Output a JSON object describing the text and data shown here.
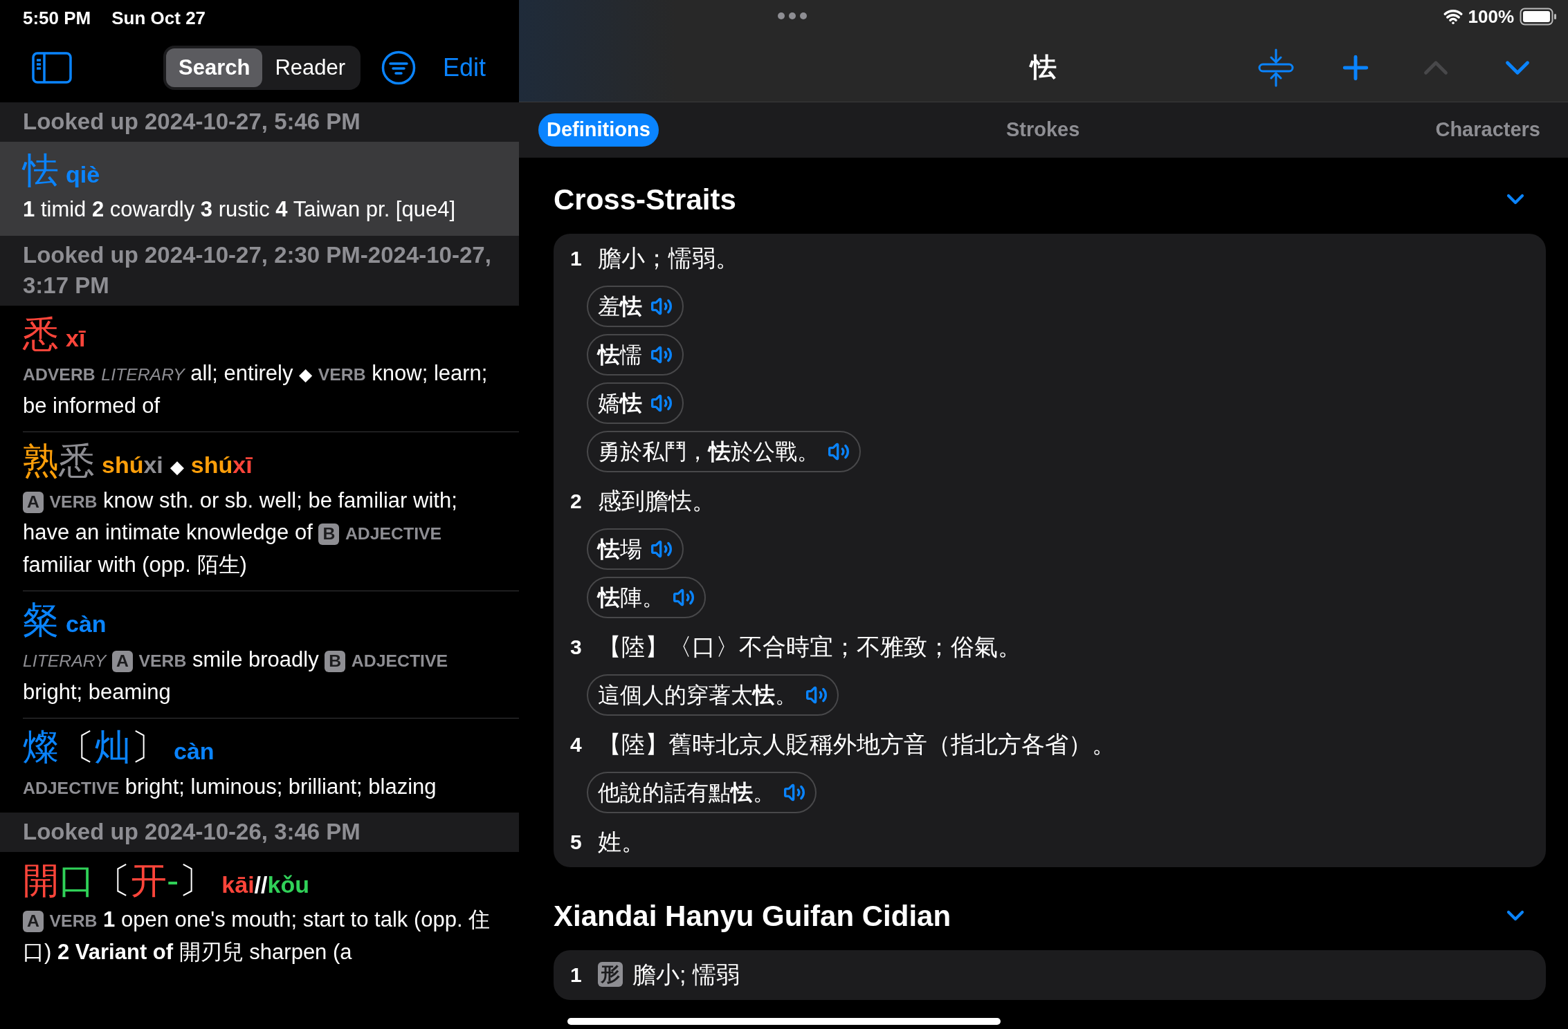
{
  "status_bar": {
    "time": "5:50 PM",
    "date": "Sun Oct 27",
    "battery": "100%"
  },
  "sidebar": {
    "modes": [
      {
        "label": "Search",
        "selected": true
      },
      {
        "label": "Reader",
        "selected": false
      }
    ],
    "edit": "Edit",
    "groups": [
      {
        "header": "Looked up 2024-10-27, 5:46 PM",
        "entries": [
          {
            "selected": true,
            "headword": [
              {
                "text": "怯",
                "color": "#0a84ff"
              }
            ],
            "readings": [
              [
                {
                  "text": "qiè",
                  "color": "#0a84ff"
                }
              ]
            ],
            "definition": [
              {
                "kind": "num",
                "text": "1"
              },
              {
                "kind": "text",
                "text": "timid"
              },
              {
                "kind": "num",
                "text": "2"
              },
              {
                "kind": "text",
                "text": "cowardly"
              },
              {
                "kind": "num",
                "text": "3"
              },
              {
                "kind": "text",
                "text": "rustic"
              },
              {
                "kind": "num",
                "text": "4"
              },
              {
                "kind": "text",
                "text": "Taiwan pr. [que4]"
              }
            ]
          }
        ]
      },
      {
        "header": "Looked up 2024-10-27, 2:30 PM-2024-10-27, 3:17 PM",
        "entries": [
          {
            "selected": false,
            "headword": [
              {
                "text": "悉",
                "color": "#ff453a"
              }
            ],
            "readings": [
              [
                {
                  "text": "xī",
                  "color": "#ff453a"
                }
              ]
            ],
            "definition": [
              {
                "kind": "pos",
                "text": "ADVERB"
              },
              {
                "kind": "register",
                "text": "LITERARY"
              },
              {
                "kind": "text",
                "text": "all; entirely"
              },
              {
                "kind": "sep",
                "text": "◆"
              },
              {
                "kind": "pos",
                "text": "VERB"
              },
              {
                "kind": "text",
                "text": "know; learn; be informed of"
              }
            ]
          },
          {
            "selected": false,
            "headword": [
              {
                "text": "熟",
                "color": "#ff9f0a"
              },
              {
                "text": "悉",
                "color": "#8e8e93"
              }
            ],
            "reading_separator": "◆",
            "readings": [
              [
                {
                  "text": "shú",
                  "color": "#ff9f0a"
                },
                {
                  "text": "xi",
                  "color": "#8e8e93"
                }
              ],
              [
                {
                  "text": "shú",
                  "color": "#ff9f0a"
                },
                {
                  "text": "xī",
                  "color": "#ff453a"
                }
              ]
            ],
            "definition": [
              {
                "kind": "badge",
                "text": "A"
              },
              {
                "kind": "pos",
                "text": "VERB"
              },
              {
                "kind": "text",
                "text": "know sth. or sb. well; be familiar with; have an intimate knowledge of"
              },
              {
                "kind": "badge",
                "text": "B"
              },
              {
                "kind": "pos",
                "text": "ADJECTIVE"
              },
              {
                "kind": "text",
                "text": "familiar with (opp. 陌生)"
              }
            ]
          },
          {
            "selected": false,
            "headword": [
              {
                "text": "粲",
                "color": "#0a84ff"
              }
            ],
            "readings": [
              [
                {
                  "text": "càn",
                  "color": "#0a84ff"
                }
              ]
            ],
            "definition": [
              {
                "kind": "register",
                "text": "LITERARY"
              },
              {
                "kind": "badge",
                "text": "A"
              },
              {
                "kind": "pos",
                "text": "VERB"
              },
              {
                "kind": "text",
                "text": "smile broadly"
              },
              {
                "kind": "badge",
                "text": "B"
              },
              {
                "kind": "pos",
                "text": "ADJECTIVE"
              },
              {
                "kind": "text",
                "text": "bright; beaming"
              }
            ]
          },
          {
            "selected": false,
            "headword": [
              {
                "text": "燦",
                "color": "#0a84ff"
              },
              {
                "text": "〔",
                "color": "#ffffff"
              },
              {
                "text": "灿",
                "color": "#0a84ff"
              },
              {
                "text": "〕",
                "color": "#ffffff"
              }
            ],
            "readings": [
              [
                {
                  "text": "càn",
                  "color": "#0a84ff"
                }
              ]
            ],
            "definition": [
              {
                "kind": "pos",
                "text": "ADJECTIVE"
              },
              {
                "kind": "text",
                "text": "bright; luminous; brilliant; blazing"
              }
            ]
          }
        ]
      },
      {
        "header": "Looked up 2024-10-26, 3:46 PM",
        "entries": [
          {
            "selected": false,
            "headword": [
              {
                "text": "開",
                "color": "#ff453a"
              },
              {
                "text": "口",
                "color": "#30d158"
              },
              {
                "text": "〔",
                "color": "#ffffff"
              },
              {
                "text": "开",
                "color": "#ff453a"
              },
              {
                "text": "-",
                "color": "#30d158"
              },
              {
                "text": "〕",
                "color": "#ffffff"
              }
            ],
            "readings": [
              [
                {
                  "text": "kāi",
                  "color": "#ff453a"
                },
                {
                  "text": "//",
                  "color": "#ffffff"
                },
                {
                  "text": "kǒu",
                  "color": "#30d158"
                }
              ]
            ],
            "definition": [
              {
                "kind": "badge",
                "text": "A"
              },
              {
                "kind": "pos",
                "text": "VERB"
              },
              {
                "kind": "num",
                "text": "1"
              },
              {
                "kind": "text",
                "text": "open one's mouth; start to talk (opp. 住口)"
              },
              {
                "kind": "num",
                "text": "2"
              },
              {
                "kind": "bold",
                "text": "Variant of"
              },
              {
                "kind": "text",
                "text": "開刃兒 sharpen (a"
              }
            ]
          }
        ]
      }
    ]
  },
  "detail": {
    "title": "怯",
    "previous_disabled": true,
    "next_disabled": false,
    "tabs": [
      {
        "label": "Definitions",
        "selected": true
      },
      {
        "label": "Strokes",
        "selected": false
      },
      {
        "label": "Characters",
        "selected": false
      }
    ],
    "dictionaries": [
      {
        "name": "Cross-Straits",
        "expanded": true,
        "senses": [
          {
            "number": "1",
            "text": "膽小；懦弱。",
            "examples": [
              "羞**怯**",
              "**怯**懦",
              "嬌**怯**",
              "勇於私鬥，**怯**於公戰。"
            ]
          },
          {
            "number": "2",
            "text": "感到膽怯。",
            "examples": [
              "**怯**場",
              "**怯**陣。"
            ]
          },
          {
            "number": "3",
            "text": "【陸】〈口〉不合時宜；不雅致；俗氣。",
            "examples": [
              "這個人的穿著太**怯**。"
            ]
          },
          {
            "number": "4",
            "text": "【陸】舊時北京人貶稱外地方音（指北方各省）。",
            "examples": [
              "他說的話有點**怯**。"
            ]
          },
          {
            "number": "5",
            "text": "姓。"
          }
        ]
      },
      {
        "name": "Xiandai Hanyu Guifan Cidian",
        "expanded": true,
        "senses": [
          {
            "number": "1",
            "badge": "形",
            "text": "膽小; 懦弱"
          }
        ]
      }
    ]
  }
}
